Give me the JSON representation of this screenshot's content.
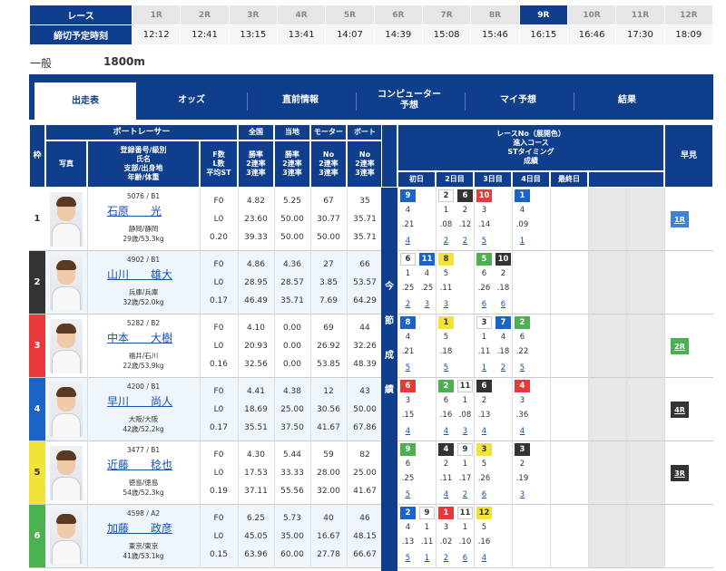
{
  "race_header": {
    "label_race": "レース",
    "label_deadline": "締切予定時刻",
    "races": [
      "1R",
      "2R",
      "3R",
      "4R",
      "5R",
      "6R",
      "7R",
      "8R",
      "9R",
      "10R",
      "11R",
      "12R"
    ],
    "times": [
      "12:12",
      "12:41",
      "13:15",
      "13:41",
      "14:07",
      "14:39",
      "15:08",
      "15:46",
      "16:15",
      "16:46",
      "17:30",
      "18:09"
    ],
    "current_index": 8
  },
  "race_info": {
    "grade": "一般",
    "distance": "1800m"
  },
  "tabs": [
    "出走表",
    "オッズ",
    "直前情報",
    "コンピューター\n予想",
    "マイ予想",
    "結果"
  ],
  "headers": {
    "waku": "枠",
    "boat_racer": "ボートレーサー",
    "photo": "写真",
    "racer_info": "登録番号/級別\n氏名\n支部/出身地\n年齢/体重",
    "flst": "F数\nL数\n平均ST",
    "national": "全国",
    "local": "当地",
    "motor": "モーター",
    "boat": "ボート",
    "national_sub": "勝率\n2連率\n3連率",
    "local_sub": "勝率\n2連率\n3連率",
    "motor_sub": "No\n2連率\n3連率",
    "boat_sub": "No\n2連率\n3連率",
    "race_no": "レースNo（展開色）\n進入コース\nSTタイミング\n成績",
    "days": [
      "初日",
      "2日目",
      "3日目",
      "4日目",
      "最終日"
    ],
    "hayami": "早見",
    "konsetsu": [
      "今",
      "節",
      "成",
      "績"
    ]
  },
  "racers": [
    {
      "waku": "1",
      "color": "#ffffff",
      "reg": "5076 / B1",
      "name": "石原　　光",
      "branch": "静岡/静岡",
      "age": "29歳/53.3kg",
      "f": "F0",
      "l": "L0",
      "st": "0.20",
      "nat": [
        "4.82",
        "23.60",
        "39.33"
      ],
      "loc": [
        "5.25",
        "50.00",
        "50.00"
      ],
      "mot": [
        "67",
        "30.77",
        "50.00"
      ],
      "boa": [
        "35",
        "35.71",
        "35.71"
      ],
      "hayami": "1R",
      "sessions": [
        {
          "r": "9",
          "c": "4",
          ".21": "",
          "s": ".21",
          "rank": "4"
        },
        {
          "r": "",
          "c": "",
          "s": "",
          "rank": ""
        },
        {
          "r": "2",
          "c": "1",
          "s": ".08",
          "rank": "2"
        },
        {
          "r": "6",
          "c": "2",
          "s": ".12",
          "rank": "2"
        },
        {
          "r": "10",
          "c": "3",
          "s": ".14",
          "rank": "5"
        },
        {
          "r": "",
          "c": "",
          "s": "",
          "rank": ""
        },
        {
          "r": "1",
          "c": "4",
          "s": ".09",
          "rank": "1"
        }
      ]
    },
    {
      "waku": "2",
      "color": "#333333",
      "reg": "4902 / B1",
      "name": "山川　　雄大",
      "branch": "兵庫/兵庫",
      "age": "32歳/52.0kg",
      "f": "F0",
      "l": "L0",
      "st": "0.17",
      "nat": [
        "4.86",
        "28.95",
        "46.49"
      ],
      "loc": [
        "4.36",
        "28.57",
        "35.71"
      ],
      "mot": [
        "27",
        "3.85",
        "7.69"
      ],
      "boa": [
        "66",
        "53.57",
        "64.29"
      ],
      "hayami": "",
      "sessions": [
        {
          "r": "6",
          "c": "1",
          "s": ".25",
          "rank": "2"
        },
        {
          "r": "11",
          "c": "4",
          "s": ".25",
          "rank": "3"
        },
        {
          "r": "8",
          "c": "5",
          "s": ".11",
          "rank": "3"
        },
        {
          "r": "",
          "c": "",
          "s": "",
          "rank": ""
        },
        {
          "r": "5",
          "c": "6",
          "s": ".26",
          "rank": "6"
        },
        {
          "r": "10",
          "c": "2",
          "s": ".18",
          "rank": "6"
        },
        {
          "r": "",
          "c": "",
          "s": "",
          "rank": ""
        }
      ]
    },
    {
      "waku": "3",
      "color": "#e8393a",
      "reg": "5282 / B2",
      "name": "中本　　大樹",
      "branch": "福井/石川",
      "age": "22歳/53.9kg",
      "f": "F0",
      "l": "L0",
      "st": "0.16",
      "nat": [
        "4.10",
        "20.93",
        "32.56"
      ],
      "loc": [
        "0.00",
        "0.00",
        "0.00"
      ],
      "mot": [
        "69",
        "26.92",
        "53.85"
      ],
      "boa": [
        "44",
        "32.26",
        "48.39"
      ],
      "hayami": "2R",
      "sessions": [
        {
          "r": "8",
          "c": "4",
          "s": ".21",
          "rank": "5"
        },
        {
          "r": "",
          "c": "",
          "s": "",
          "rank": ""
        },
        {
          "r": "1",
          "c": "5",
          "s": ".18",
          "rank": "5"
        },
        {
          "r": "",
          "c": "",
          "s": "",
          "rank": ""
        },
        {
          "r": "3",
          "c": "1",
          "s": ".11",
          "rank": "1"
        },
        {
          "r": "7",
          "c": "4",
          "s": ".18",
          "rank": "2"
        },
        {
          "r": "2",
          "c": "6",
          "s": ".22",
          "rank": "5"
        }
      ]
    },
    {
      "waku": "4",
      "color": "#1a64c8",
      "reg": "4200 / B1",
      "name": "早川　　尚人",
      "branch": "大阪/大阪",
      "age": "42歳/52.2kg",
      "f": "F0",
      "l": "L0",
      "st": "0.17",
      "nat": [
        "4.41",
        "18.69",
        "35.51"
      ],
      "loc": [
        "4.38",
        "25.00",
        "37.50"
      ],
      "mot": [
        "12",
        "30.56",
        "41.67"
      ],
      "boa": [
        "43",
        "50.00",
        "67.86"
      ],
      "hayami": "4R",
      "sessions": [
        {
          "r": "6",
          "c": "3",
          "s": ".15",
          "rank": "4"
        },
        {
          "r": "",
          "c": "",
          "s": "",
          "rank": ""
        },
        {
          "r": "2",
          "c": "6",
          "s": ".16",
          "rank": "4"
        },
        {
          "r": "11",
          "c": "1",
          "s": ".08",
          "rank": "3"
        },
        {
          "r": "6",
          "c": "2",
          "s": ".13",
          "rank": "4"
        },
        {
          "r": "",
          "c": "",
          "s": "",
          "rank": ""
        },
        {
          "r": "4",
          "c": "3",
          "s": ".36",
          "rank": "4"
        }
      ]
    },
    {
      "waku": "5",
      "color": "#f2e33a",
      "reg": "3477 / B1",
      "name": "近藤　　稔也",
      "branch": "徳島/徳島",
      "age": "54歳/52.3kg",
      "f": "F0",
      "l": "L0",
      "st": "0.19",
      "nat": [
        "4.30",
        "17.53",
        "37.11"
      ],
      "loc": [
        "5.44",
        "33.33",
        "55.56"
      ],
      "mot": [
        "59",
        "28.00",
        "32.00"
      ],
      "boa": [
        "82",
        "25.00",
        "41.67"
      ],
      "hayami": "3R",
      "sessions": [
        {
          "r": "9",
          "c": "6",
          "s": ".25",
          "rank": "5"
        },
        {
          "r": "",
          "c": "",
          "s": "",
          "rank": ""
        },
        {
          "r": "4",
          "c": "2",
          "s": ".11",
          "rank": "4"
        },
        {
          "r": "9",
          "c": "1",
          "s": ".17",
          "rank": "2"
        },
        {
          "r": "3",
          "c": "5",
          "s": ".26",
          "rank": "6"
        },
        {
          "r": "",
          "c": "",
          "s": "",
          "rank": ""
        },
        {
          "r": "3",
          "c": "2",
          "s": ".19",
          "rank": "3"
        }
      ]
    },
    {
      "waku": "6",
      "color": "#4caf50",
      "reg": "4598 / A2",
      "name": "加藤　　政彦",
      "branch": "東京/東京",
      "age": "41歳/53.1kg",
      "f": "F0",
      "l": "L0",
      "st": "0.15",
      "nat": [
        "6.25",
        "45.05",
        "63.96"
      ],
      "loc": [
        "5.73",
        "35.00",
        "60.00"
      ],
      "mot": [
        "40",
        "16.67",
        "27.78"
      ],
      "boa": [
        "46",
        "48.15",
        "66.67"
      ],
      "hayami": "",
      "sessions": [
        {
          "r": "2",
          "c": "4",
          "s": ".13",
          "rank": "5"
        },
        {
          "r": "9",
          "c": "1",
          "s": ".11",
          "rank": "1"
        },
        {
          "r": "1",
          "c": "3",
          "s": ".02",
          "rank": "2"
        },
        {
          "r": "11",
          "c": "1",
          "s": ".10",
          "rank": "6"
        },
        {
          "r": "12",
          "c": "5",
          "s": ".16",
          "rank": "4"
        },
        {
          "r": "",
          "c": "",
          "s": "",
          "rank": ""
        },
        {
          "r": "",
          "c": "",
          "s": "",
          "rank": ""
        }
      ]
    }
  ],
  "colors": {
    "navy": "#0f3f8c",
    "link": "#1550b4"
  }
}
